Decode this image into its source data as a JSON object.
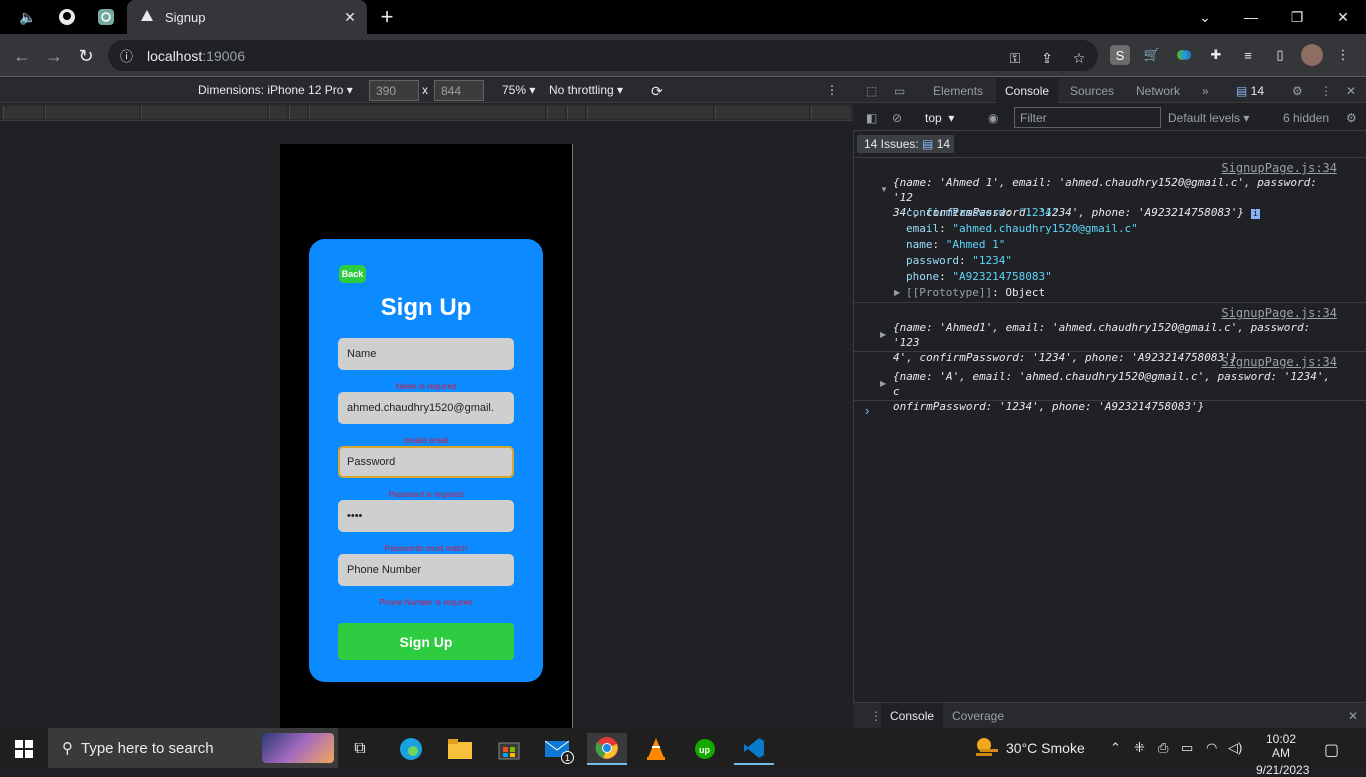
{
  "browser": {
    "tab_title": "Signup",
    "new_tab_symbol": "+",
    "url_host": "localhost",
    "url_port": ":19006"
  },
  "device_toolbar": {
    "dimensions_label": "Dimensions: iPhone 12 Pro",
    "width": "390",
    "height": "844",
    "times": "x",
    "zoom": "75%",
    "throttling": "No throttling"
  },
  "app": {
    "back_label": "Back",
    "heading": "Sign Up",
    "fields": {
      "name_placeholder": "Name",
      "email_value": "ahmed.chaudhry1520@gmail.",
      "password_placeholder": "Password",
      "confirm_value": "••••",
      "phone_placeholder": "Phone Number"
    },
    "errors": {
      "name": "Name is required",
      "email": "Invalid email",
      "password": "Password is required",
      "confirm": "Passwords must match",
      "phone": "Phone Number is required"
    },
    "submit_label": "Sign Up"
  },
  "devtools": {
    "tabs": [
      "Elements",
      "Console",
      "Sources",
      "Network"
    ],
    "issues_badge": "14",
    "context": "top",
    "filter_placeholder": "Filter",
    "levels": "Default levels",
    "hidden": "6 hidden",
    "issues_label": "14 Issues:",
    "issues_count": "14",
    "source": "SignupPage.js:34",
    "log1_line1": "{name: 'Ahmed 1', email: 'ahmed.chaudhry1520@gmail.c', password: '12",
    "log1_line2": "34', confirmPassword: '1234', phone: 'A923214758083'}",
    "log1_props": [
      {
        "key": "confirmPassword",
        "value": "\"1234\""
      },
      {
        "key": "email",
        "value": "\"ahmed.chaudhry1520@gmail.c\""
      },
      {
        "key": "name",
        "value": "\"Ahmed 1\""
      },
      {
        "key": "password",
        "value": "\"1234\""
      },
      {
        "key": "phone",
        "value": "\"A923214758083\""
      }
    ],
    "log1_proto_key": "[[Prototype]]",
    "log1_proto_val": "Object",
    "log2_line1": "{name: 'Ahmed1', email: 'ahmed.chaudhry1520@gmail.c', password: '123",
    "log2_line2": "4', confirmPassword: '1234', phone: 'A923214758083'}",
    "log3_line1": "{name: 'A', email: 'ahmed.chaudhry1520@gmail.c', password: '1234', c",
    "log3_line2": "onfirmPassword: '1234', phone: 'A923214758083'}",
    "drawer_tabs": [
      "Console",
      "Coverage"
    ]
  },
  "taskbar": {
    "search_placeholder": "Type here to search",
    "weather": "30°C  Smoke",
    "time": "10:02 AM",
    "date": "9/21/2023",
    "mail_badge": "1"
  },
  "colors": {
    "card": "#0b8bff",
    "accent_green": "#2ecc40",
    "error": "#d3183c"
  }
}
